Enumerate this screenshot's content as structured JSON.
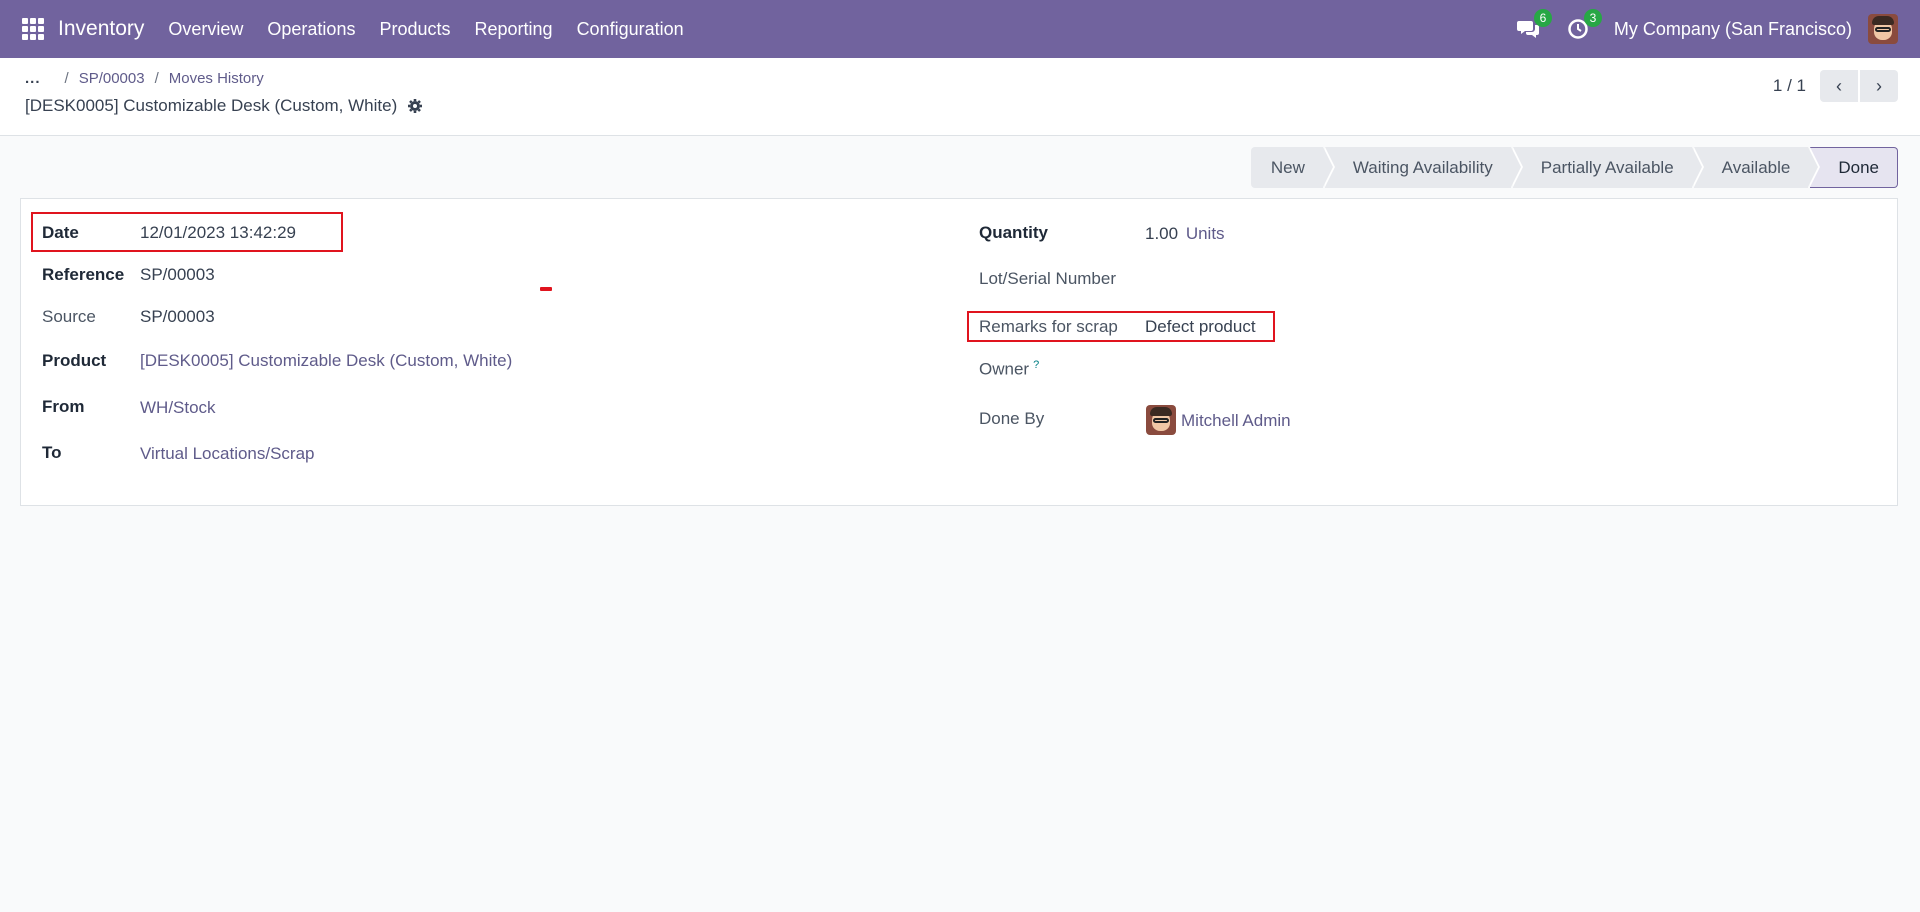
{
  "navbar": {
    "app_name": "Inventory",
    "menu": [
      "Overview",
      "Operations",
      "Products",
      "Reporting",
      "Configuration"
    ],
    "messages_badge": "6",
    "activities_badge": "3",
    "company": "My Company (San Francisco)"
  },
  "breadcrumb": {
    "more": "...",
    "items": [
      "SP/00003",
      "Moves History"
    ],
    "separator": "/"
  },
  "record": {
    "title": "[DESK0005] Customizable Desk (Custom, White)"
  },
  "pager": {
    "value": "1 / 1"
  },
  "status": {
    "stages": [
      "New",
      "Waiting Availability",
      "Partially Available",
      "Available",
      "Done"
    ],
    "active": "Done"
  },
  "form": {
    "date_label": "Date",
    "date_value": "12/01/2023 13:42:29",
    "reference_label": "Reference",
    "reference_value": "SP/00003",
    "source_label": "Source",
    "source_value": "SP/00003",
    "product_label": "Product",
    "product_value": "[DESK0005] Customizable Desk (Custom, White)",
    "from_label": "From",
    "from_value": "WH/Stock",
    "to_label": "To",
    "to_value": "Virtual Locations/Scrap",
    "quantity_label": "Quantity",
    "quantity_value": "1.00",
    "quantity_uom": "Units",
    "lot_label": "Lot/Serial Number",
    "remarks_label": "Remarks for scrap",
    "remarks_value": "Defect product",
    "owner_label": "Owner",
    "owner_help": "?",
    "done_by_label": "Done By",
    "done_by_value": "Mitchell Admin"
  },
  "colors": {
    "navbar": "#71639e",
    "link": "#5f5b8a",
    "highlight": "#e0141e",
    "badge": "#27a745"
  }
}
